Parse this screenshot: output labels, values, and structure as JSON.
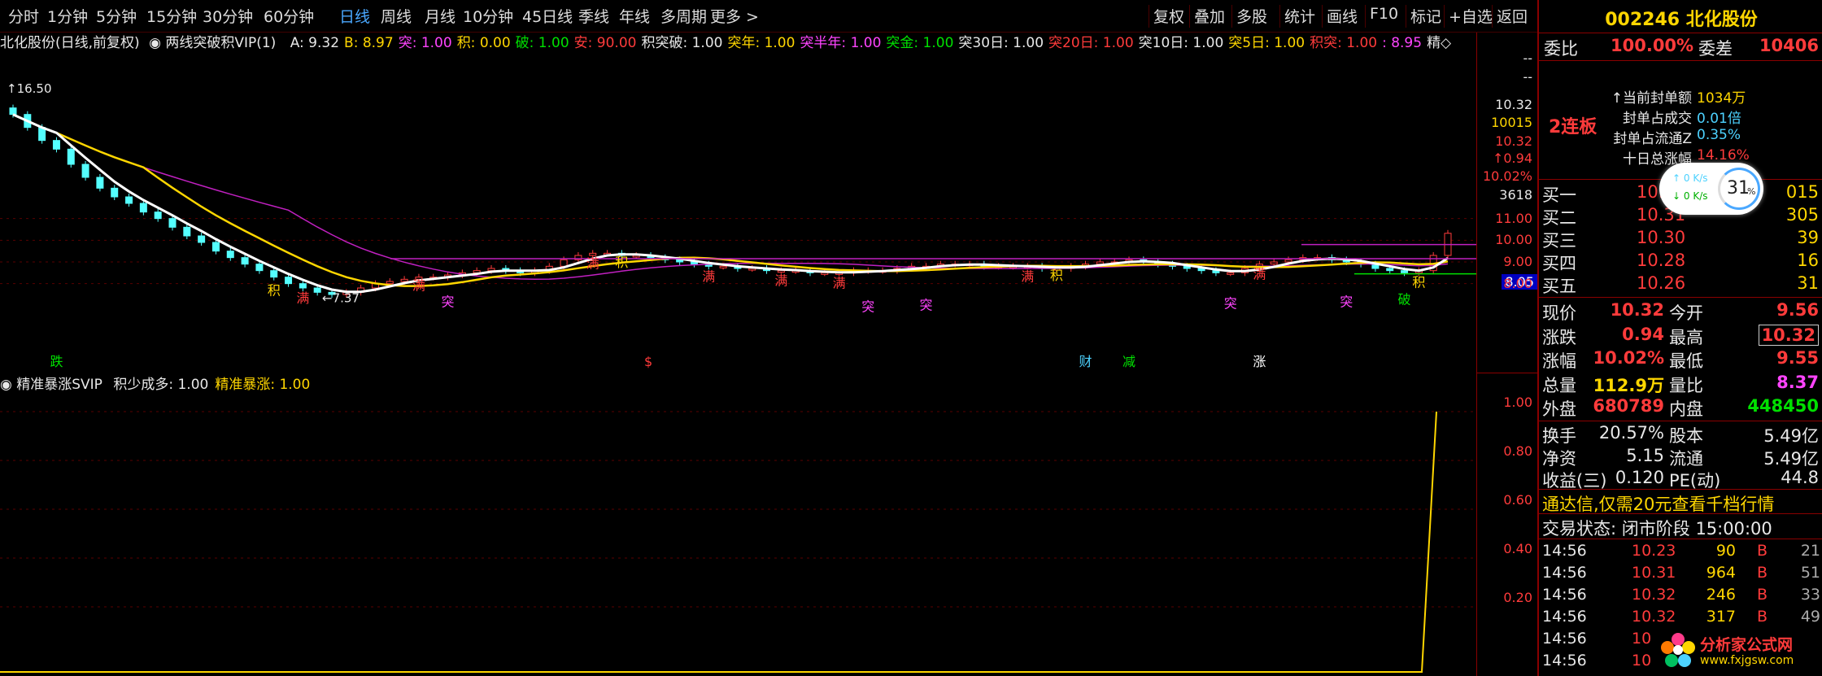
{
  "toolbar": {
    "periods": [
      "分时",
      "1分钟",
      "5分钟",
      "15分钟",
      "30分钟",
      "60分钟",
      "日线",
      "周线",
      "月线",
      "10分钟",
      "45日线",
      "季线",
      "年线",
      "多周期",
      "更多 >"
    ],
    "active_period": "日线",
    "right_buttons": [
      "复权",
      "叠加",
      "多股",
      "统计",
      "画线",
      "F10",
      "标记",
      "+自选",
      "返回"
    ]
  },
  "main_legend": {
    "stock": "北化股份(日线,前复权)",
    "indicator": "两线突破积VIP(1)",
    "items": [
      {
        "label": "A: 9.32",
        "color": "#e8e8e8"
      },
      {
        "label": "B: 8.97",
        "color": "#ffd600"
      },
      {
        "label": "突: 1.00",
        "color": "#ff44ff"
      },
      {
        "label": "积: 0.00",
        "color": "#ffd600"
      },
      {
        "label": "破: 1.00",
        "color": "#00e000"
      },
      {
        "label": "安: 90.00",
        "color": "#ff3b3b"
      },
      {
        "label": "积突破: 1.00",
        "color": "#e8e8e8"
      },
      {
        "label": "突年: 1.00",
        "color": "#ffd600"
      },
      {
        "label": "突半年: 1.00",
        "color": "#ff44ff"
      },
      {
        "label": "突金: 1.00",
        "color": "#00e000"
      },
      {
        "label": "突30日: 1.00",
        "color": "#e8e8e8"
      },
      {
        "label": "突20日: 1.00",
        "color": "#ff3b3b"
      },
      {
        "label": "突10日: 1.00",
        "color": "#e8e8e8"
      },
      {
        "label": "突5日: 1.00",
        "color": "#ffd600"
      },
      {
        "label": "积突: 1.00",
        "color": "#ff3b3b"
      },
      {
        "label": ": 8.95",
        "color": "#ff44ff"
      },
      {
        "label": "精◇",
        "color": "#e8e8e8"
      }
    ]
  },
  "sub_legend": {
    "indicator": "精准暴涨SVIP",
    "items": [
      {
        "label": "积少成多: 1.00",
        "color": "#e8e8e8"
      },
      {
        "label": "精准暴涨: 1.00",
        "color": "#ffd600"
      }
    ]
  },
  "price_axis": {
    "top_labels": [
      {
        "text": "--",
        "color": "#e8e8e8"
      },
      {
        "text": "--",
        "color": "#e8e8e8"
      },
      {
        "text": "10.32",
        "color": "#e8e8e8"
      },
      {
        "text": "10015",
        "color": "#ffd600"
      },
      {
        "text": "10.32",
        "color": "#ff3b3b"
      },
      {
        "text": "↑0.94",
        "color": "#ff3b3b"
      },
      {
        "text": "10.02%",
        "color": "#ff3b3b"
      },
      {
        "text": "3618",
        "color": "#e8e8e8"
      }
    ],
    "ticks": [
      "11.00",
      "10.00",
      "9.00",
      "8.05",
      "8.00"
    ],
    "current_marker": "8.05",
    "high_label": "16.50",
    "low_label": "7.37"
  },
  "sub_axis": {
    "ticks": [
      "1.00",
      "0.80",
      "0.60",
      "0.40",
      "0.20"
    ]
  },
  "chart_data": {
    "type": "candlestick",
    "ylim": [
      7.0,
      17.0
    ],
    "high_marker": 16.5,
    "low_marker": 7.37,
    "last_close": 10.32,
    "close_series": [
      15.8,
      15.2,
      14.6,
      14.2,
      13.5,
      12.9,
      12.4,
      12.0,
      11.7,
      11.3,
      11.0,
      10.6,
      10.2,
      9.9,
      9.5,
      9.2,
      8.9,
      8.6,
      8.3,
      8.0,
      7.8,
      7.6,
      7.5,
      7.6,
      7.8,
      8.0,
      8.1,
      8.2,
      8.3,
      8.3,
      8.4,
      8.5,
      8.6,
      8.7,
      8.6,
      8.5,
      8.6,
      8.8,
      9.1,
      9.3,
      9.4,
      9.4,
      9.3,
      9.3,
      9.2,
      9.1,
      9.0,
      8.9,
      8.8,
      8.8,
      8.7,
      8.7,
      8.6,
      8.6,
      8.6,
      8.5,
      8.5,
      8.5,
      8.6,
      8.6,
      8.6,
      8.7,
      8.8,
      8.8,
      8.9,
      8.9,
      8.9,
      8.8,
      8.8,
      8.8,
      8.8,
      8.7,
      8.7,
      8.8,
      8.9,
      9.0,
      9.0,
      9.1,
      9.0,
      8.9,
      8.8,
      8.7,
      8.6,
      8.5,
      8.5,
      8.7,
      8.9,
      9.0,
      9.1,
      9.2,
      9.2,
      9.1,
      9.0,
      8.9,
      8.7,
      8.6,
      8.5,
      8.6,
      9.3,
      10.32
    ],
    "sub_signal": {
      "name": "精准暴涨",
      "final_value": 1.0
    }
  },
  "signals": {
    "chart_labels": [
      {
        "text": "跌",
        "color": "#00e000"
      },
      {
        "text": "积",
        "color": "#ffd600"
      },
      {
        "text": "满",
        "color": "#ff3b3b"
      },
      {
        "text": "满",
        "color": "#ff3b3b"
      },
      {
        "text": "突",
        "color": "#ff44ff"
      },
      {
        "text": "满",
        "color": "#ff3b3b"
      },
      {
        "text": "积",
        "color": "#ffd600"
      },
      {
        "text": "满",
        "color": "#ff3b3b"
      },
      {
        "text": "满",
        "color": "#ff3b3b"
      },
      {
        "text": "满",
        "color": "#ff3b3b"
      },
      {
        "text": "突",
        "color": "#ff44ff"
      },
      {
        "text": "突",
        "color": "#ff44ff"
      },
      {
        "text": "满",
        "color": "#ff3b3b"
      },
      {
        "text": "积",
        "color": "#ffd600"
      },
      {
        "text": "突",
        "color": "#ff44ff"
      },
      {
        "text": "满",
        "color": "#ff3b3b"
      },
      {
        "text": "突",
        "color": "#ff44ff"
      },
      {
        "text": "破",
        "color": "#00e000"
      },
      {
        "text": "积",
        "color": "#ffd600"
      },
      {
        "text": "$",
        "color": "#ff3b3b"
      },
      {
        "text": "财",
        "color": "#4dd2ff"
      },
      {
        "text": "减",
        "color": "#00e000"
      },
      {
        "text": "涨",
        "color": "#ffffff"
      }
    ]
  },
  "quote": {
    "code": "002246",
    "name": "北化股份",
    "weibi_label": "委比",
    "weibi_value": "100.00%",
    "weicha_label": "委差",
    "weicha_value": "10406",
    "lianban": "2连板",
    "seal_rows": [
      {
        "label": "↑当前封单额",
        "value": "1034万",
        "color": "#ffd600"
      },
      {
        "label": "封单占成交",
        "value": "0.01倍",
        "color": "#4dd2ff"
      },
      {
        "label": "封单占流通Z",
        "value": "0.35%",
        "color": "#4dd2ff"
      },
      {
        "label": "十日总涨幅",
        "value": "14.16%",
        "color": "#ff3b3b"
      }
    ],
    "buy_orders": [
      {
        "label": "买一",
        "price": "10.32",
        "volume": "015"
      },
      {
        "label": "买二",
        "price": "10.31",
        "volume": "305"
      },
      {
        "label": "买三",
        "price": "10.30",
        "volume": "39"
      },
      {
        "label": "买四",
        "price": "10.28",
        "volume": "16"
      },
      {
        "label": "买五",
        "price": "10.26",
        "volume": "31"
      }
    ],
    "stats": [
      {
        "l1": "现价",
        "v1": "10.32",
        "c1": "#ff3b3b",
        "l2": "今开",
        "v2": "9.56",
        "c2": "#ff3b3b"
      },
      {
        "l1": "涨跌",
        "v1": "0.94",
        "c1": "#ff3b3b",
        "l2": "最高",
        "v2": "10.32",
        "c2": "#ff3b3b"
      },
      {
        "l1": "涨幅",
        "v1": "10.02%",
        "c1": "#ff3b3b",
        "l2": "最低",
        "v2": "9.55",
        "c2": "#ff3b3b"
      },
      {
        "l1": "总量",
        "v1": "112.9万",
        "c1": "#ffd600",
        "l2": "量比",
        "v2": "8.37",
        "c2": "#ff44ff"
      },
      {
        "l1": "外盘",
        "v1": "680789",
        "c1": "#ff3b3b",
        "l2": "内盘",
        "v2": "448450",
        "c2": "#00e000"
      }
    ],
    "stats2": [
      {
        "l1": "换手",
        "v1": "20.57%",
        "l2": "股本",
        "v2": "5.49亿"
      },
      {
        "l1": "净资",
        "v1": "5.15",
        "l2": "流通",
        "v2": "5.49亿"
      },
      {
        "l1": "收益(三)",
        "v1": "0.120",
        "l2": "PE(动)",
        "v2": "44.8"
      }
    ],
    "promo": "通达信,仅需20元查看千档行情",
    "trade_status_label": "交易状态:",
    "trade_status": "闭市阶段 15:00:00",
    "ticks": [
      {
        "time": "14:56",
        "price": "10.23",
        "vol": "90",
        "side": "B",
        "n": "21"
      },
      {
        "time": "14:56",
        "price": "10.31",
        "vol": "964",
        "side": "B",
        "n": "51"
      },
      {
        "time": "14:56",
        "price": "10.32",
        "vol": "246",
        "side": "B",
        "n": "33"
      },
      {
        "time": "14:56",
        "price": "10.32",
        "vol": "317",
        "side": "B",
        "n": "49"
      },
      {
        "time": "14:56",
        "price": "10",
        "vol": "",
        "side": "",
        "n": ""
      },
      {
        "time": "14:56",
        "price": "10",
        "vol": "",
        "side": "",
        "n": ""
      }
    ],
    "speed": {
      "up": "0 K/s",
      "down": "0 K/s",
      "percent": "31",
      "unit": "%"
    },
    "logo_text": "分析家公式网",
    "logo_url": "www.fxjgsw.com"
  }
}
